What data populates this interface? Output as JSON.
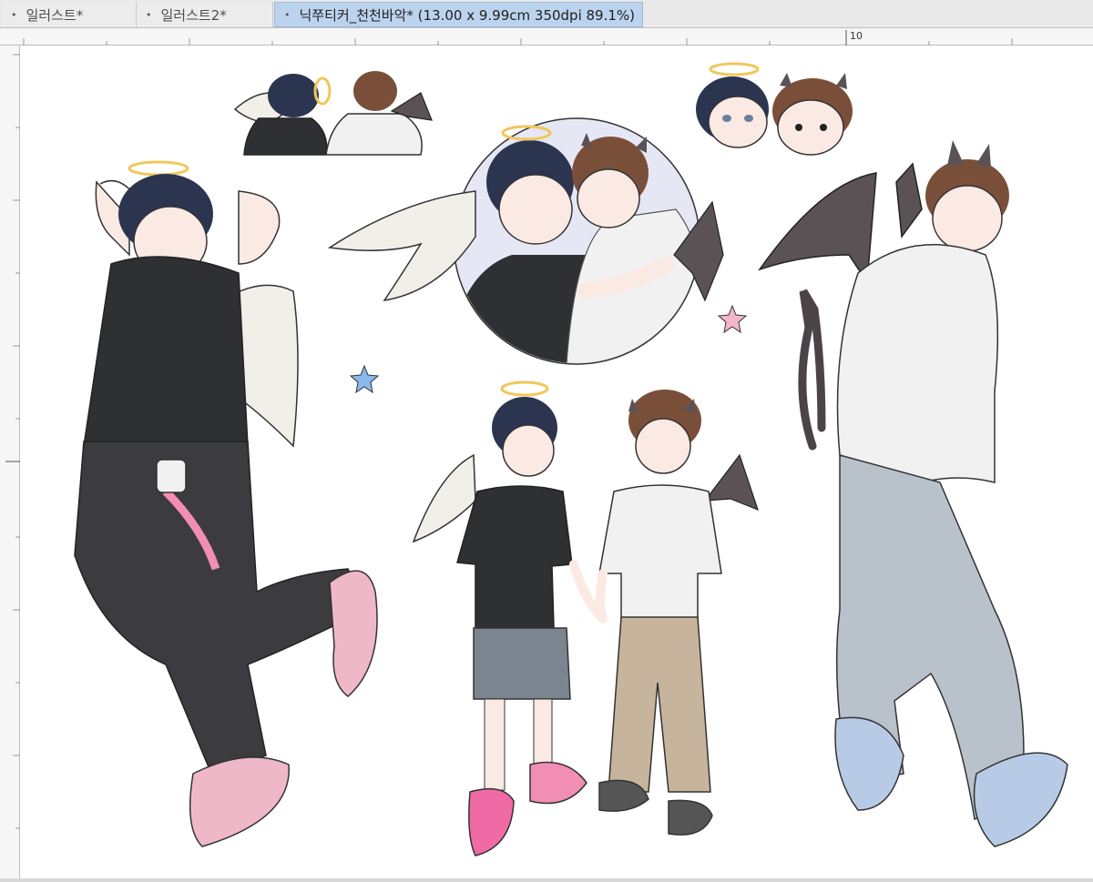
{
  "tabs": [
    {
      "label": "일러스트*",
      "active": false
    },
    {
      "label": "일러스트2*",
      "active": false
    },
    {
      "label": "닉쭈티커_천천바악* (13.00 x 9.99cm 350dpi 89.1%)",
      "active": true
    }
  ],
  "ruler": {
    "top_label": "10"
  },
  "icons": {
    "tab_dot": "•"
  },
  "colors": {
    "tab_active_bg": "#bcd3ee",
    "tab_inactive_bg": "#ececec",
    "canvas_bg": "#ffffff",
    "hair_dark": "#2c3550",
    "hair_brown": "#7a4f39",
    "halo": "#f0c75a",
    "wing_white": "#f1efe8",
    "wing_bat": "#5b5256",
    "shirt_black": "#2f3033",
    "hoodie_white": "#f1f1f1",
    "jeans_light": "#b9c2cb",
    "pants_dark": "#3c3b40",
    "shoe_pink": "#efb8c8",
    "shoe_blue": "#b8cbe6",
    "star_pink": "#f4b6c9",
    "star_blue": "#8ab8ea"
  }
}
